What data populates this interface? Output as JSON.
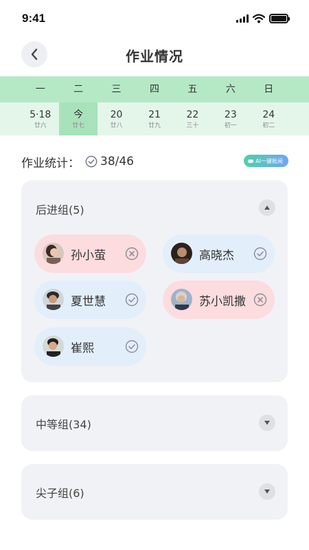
{
  "status_bar": {
    "time": "9:41"
  },
  "nav": {
    "title": "作业情况"
  },
  "week": {
    "days": [
      "一",
      "二",
      "三",
      "四",
      "五",
      "六",
      "日"
    ],
    "dates": [
      {
        "main": "5·18",
        "sub": "廿六"
      },
      {
        "main": "今",
        "sub": "廿七",
        "active": true
      },
      {
        "main": "20",
        "sub": "廿八"
      },
      {
        "main": "21",
        "sub": "廿九"
      },
      {
        "main": "22",
        "sub": "三十"
      },
      {
        "main": "23",
        "sub": "初一"
      },
      {
        "main": "24",
        "sub": "初二"
      }
    ]
  },
  "stats": {
    "label": "作业统计：",
    "count": "38/46",
    "ai_button": "AI一键批阅"
  },
  "groups": [
    {
      "title": "后进组(5)",
      "expanded": true,
      "students": [
        {
          "name": "孙小萤",
          "status": "fail",
          "status_icon": "close-circle-icon"
        },
        {
          "name": "高晓杰",
          "status": "pass",
          "status_icon": "check-circle-icon"
        },
        {
          "name": "夏世慧",
          "status": "pass",
          "status_icon": "check-circle-icon"
        },
        {
          "name": "苏小凯撒",
          "status": "fail",
          "status_icon": "close-circle-icon"
        },
        {
          "name": "崔熙",
          "status": "pass",
          "status_icon": "check-circle-icon"
        }
      ]
    },
    {
      "title": "中等组(34)",
      "expanded": false
    },
    {
      "title": "尖子组(6)",
      "expanded": false
    }
  ],
  "colors": {
    "week_header_bg": "#b5e9c6",
    "date_row_bg": "#e4f6ea",
    "active_date_bg": "#a8e2bb",
    "fail_chip_bg": "#fcdcdf",
    "pass_chip_bg": "#e3eefb",
    "card_bg": "#f1f2f6"
  }
}
